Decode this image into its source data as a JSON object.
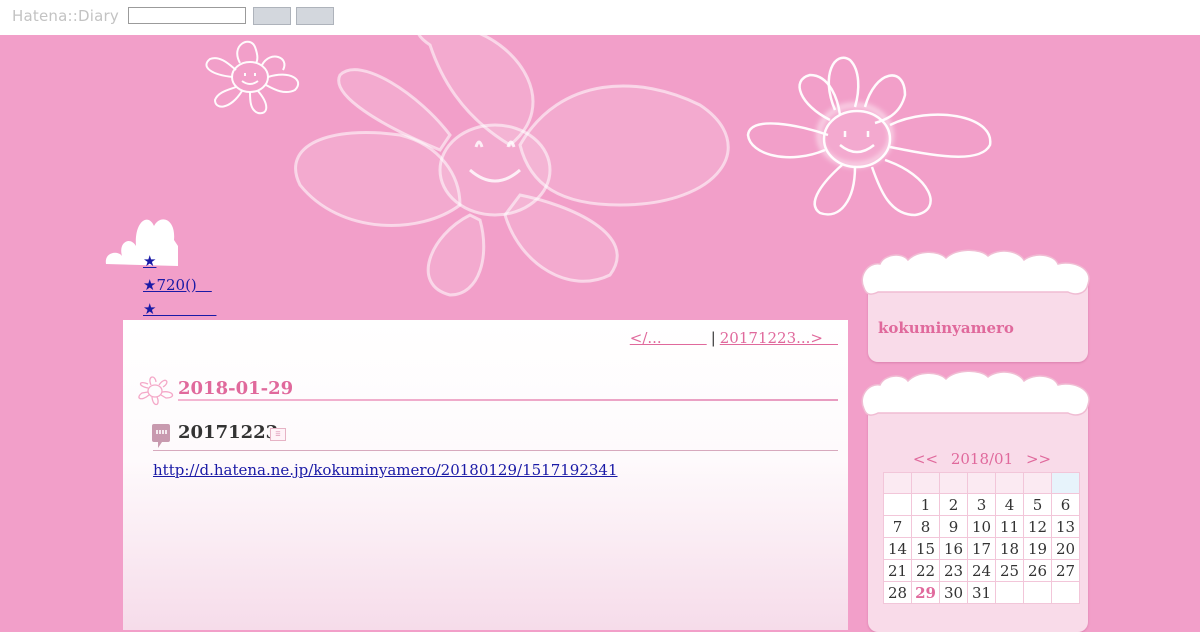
{
  "topbar": {
    "brand": "Hatena::Diary",
    "search_placeholder": "",
    "button1_label": "",
    "button2_label": ""
  },
  "star_links": [
    "★",
    "★720()　",
    "★　　　　"
  ],
  "pager": {
    "prev": "</...　　　",
    "separator": "|",
    "next": "20171223...>　"
  },
  "day": {
    "date": "2018-01-29",
    "entry_title": "20171223",
    "entry_link": "http://d.hatena.ne.jp/kokuminyamero/20180129/1517192341"
  },
  "sidebar": {
    "user_name": "kokuminyamero",
    "calendar": {
      "prev": "<<",
      "month": "2018/01",
      "next": ">>",
      "header": [
        "",
        "",
        "",
        "",
        "",
        "",
        ""
      ],
      "weeks": [
        [
          "",
          "1",
          "2",
          "3",
          "4",
          "5",
          "6"
        ],
        [
          "7",
          "8",
          "9",
          "10",
          "11",
          "12",
          "13"
        ],
        [
          "14",
          "15",
          "16",
          "17",
          "18",
          "19",
          "20"
        ],
        [
          "21",
          "22",
          "23",
          "24",
          "25",
          "26",
          "27"
        ],
        [
          "28",
          "29",
          "30",
          "31",
          "",
          "",
          ""
        ]
      ],
      "linked_day": "29"
    }
  },
  "colors": {
    "background": "#f29fc9",
    "accent_pink": "#e0699c",
    "link_blue": "#1a1aa6"
  }
}
